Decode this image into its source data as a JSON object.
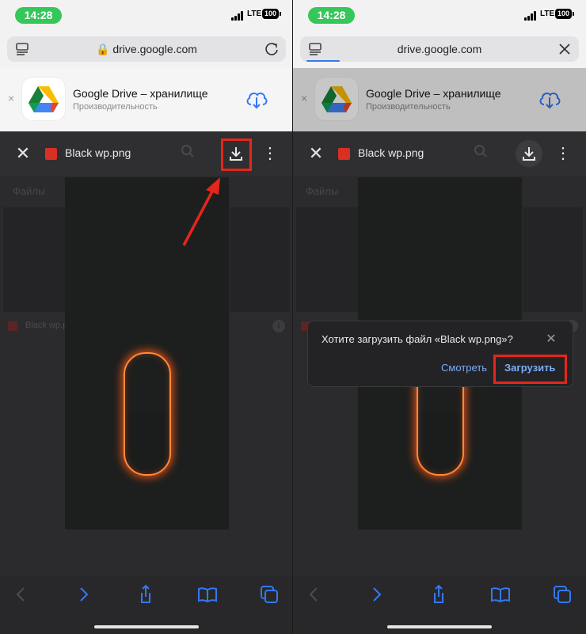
{
  "status": {
    "time": "14:28",
    "network": "LTE",
    "battery": "100"
  },
  "browser": {
    "url": "drive.google.com",
    "reader_icon": "reader-icon",
    "reload_icon": "reload-icon",
    "close_icon": "close-icon"
  },
  "banner": {
    "title": "Google Drive – хранилище",
    "subtitle": "Производительность",
    "close": "×"
  },
  "viewer": {
    "close": "✕",
    "filename": "Black wp.png",
    "more": "⋮"
  },
  "background": {
    "section_label": "Файлы",
    "file_row": "Black wp.png",
    "info": "i"
  },
  "dialog": {
    "message": "Хотите загрузить файл «Black wp.png»?",
    "close": "✕",
    "view_button": "Смотреть",
    "download_button": "Загрузить"
  },
  "colors": {
    "accent": "#3478f6",
    "highlight": "#e5261b",
    "status_green": "#35c759",
    "dialog_link": "#7cacf8"
  }
}
